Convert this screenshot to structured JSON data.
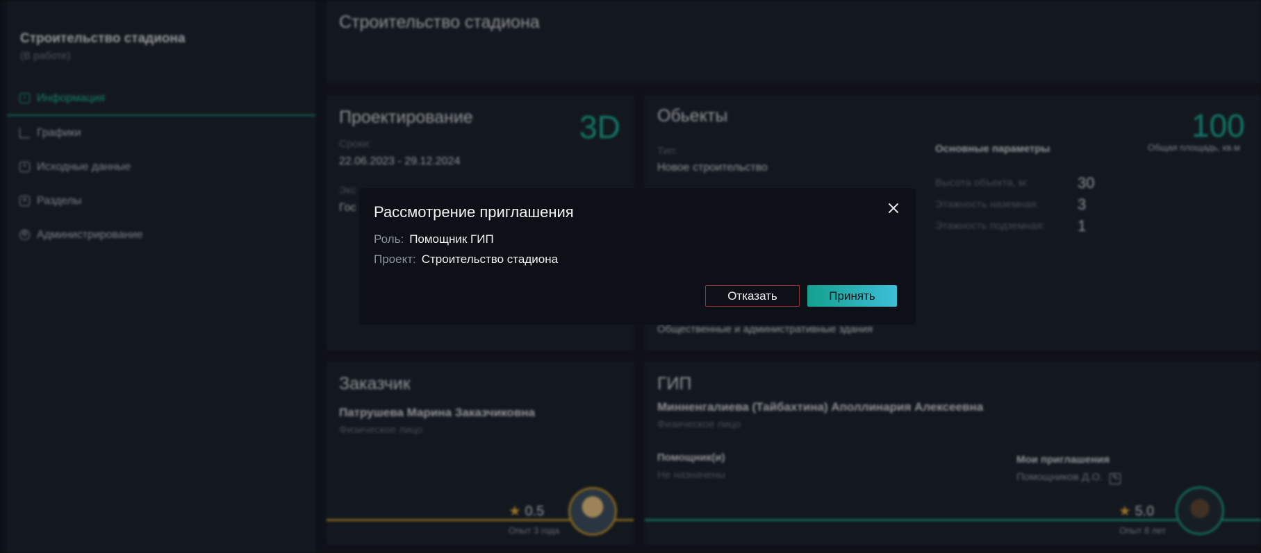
{
  "sidebar": {
    "project_title": "Строительство стадиона",
    "project_status": "(В работе)",
    "items": [
      {
        "label": "Информация",
        "icon": "info-icon",
        "active": true
      },
      {
        "label": "Графики",
        "icon": "chart-icon"
      },
      {
        "label": "Исходные данные",
        "icon": "upload-icon"
      },
      {
        "label": "Разделы",
        "icon": "sections-icon"
      },
      {
        "label": "Администрирование",
        "icon": "gear-icon"
      }
    ]
  },
  "header": {
    "title": "Строительство стадиона"
  },
  "design_card": {
    "title": "Проектирование",
    "badge": "3D",
    "dates_label": "Сроки:",
    "dates_value": "22.06.2023 - 29.12.2024",
    "field2_label": "Экс",
    "field2_value": "Гос"
  },
  "objects_card": {
    "title": "Обьекты",
    "area_value": "100",
    "area_label": "Общая площадь, кв.м",
    "type_label": "Тип:",
    "type_value": "Новое строительство",
    "params_title": "Основные параметры",
    "params": [
      {
        "label": "Высота объекта, м:",
        "value": "30"
      },
      {
        "label": "Этажность наземная:",
        "value": "3"
      },
      {
        "label": "Этажность подземная:",
        "value": "1"
      }
    ],
    "purpose_value": "Общественные и административные здания"
  },
  "customer_card": {
    "title": "Заказчик",
    "name": "Патрушева Марина Заказчиковна",
    "entity": "Физическое лицо",
    "rating": "0.5",
    "experience": "Опыт 3 года"
  },
  "gip_card": {
    "title": "ГИП",
    "name": "Минненгалиева (Тайбахтина) Аполлинария Алексеевна",
    "entity": "Физическое лицо",
    "assistants_label": "Помощник(и)",
    "assistants_value": "Не назначены",
    "invites_label": "Мои приглашения",
    "invites_value": "Помощников Д.О.",
    "rating": "5.0",
    "experience": "Опыт 8 лет"
  },
  "modal": {
    "title": "Рассмотрение приглашения",
    "role_label": "Роль:",
    "role_value": "Помощник ГИП",
    "project_label": "Проект:",
    "project_value": "Строительство стадиона",
    "decline_label": "Отказать",
    "accept_label": "Принять"
  },
  "colors": {
    "accent": "#1aa58f",
    "decline_border": "#9a2e35",
    "accept_gradient_start": "#14a08e",
    "accept_gradient_end": "#3cc0d8",
    "rating_gold": "#b58a2b"
  }
}
